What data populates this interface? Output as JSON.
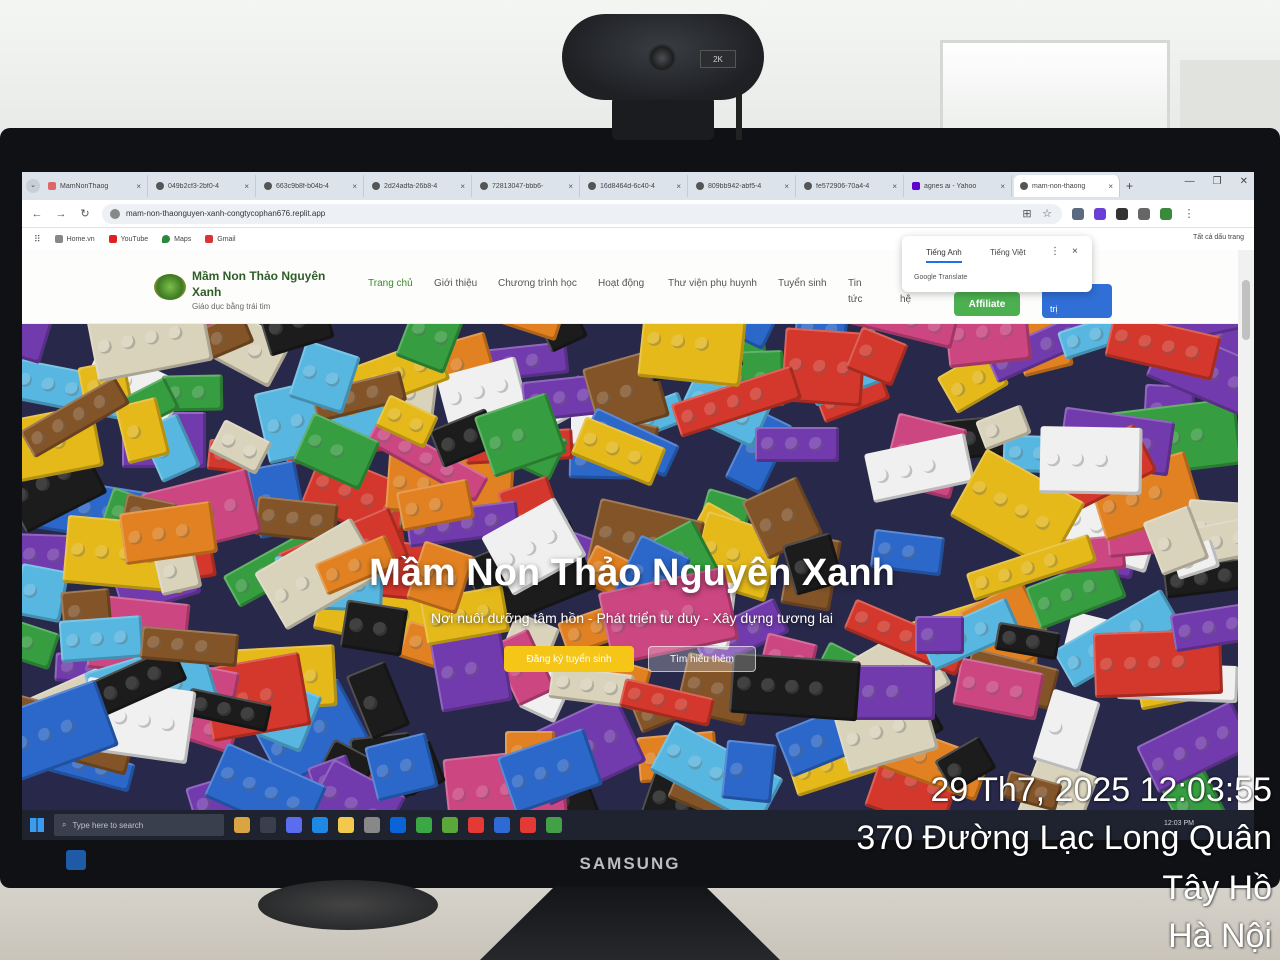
{
  "browser": {
    "tabs": [
      {
        "label": "MamNonThaog",
        "icon": "mnt-icon"
      },
      {
        "label": "049b2cf3-2bf0-4",
        "icon": "globe-icon"
      },
      {
        "label": "663c9b8f-b04b-4",
        "icon": "globe-icon"
      },
      {
        "label": "2d24adfa-26b8-4",
        "icon": "globe-icon"
      },
      {
        "label": "72813047-bbb6-",
        "icon": "globe-icon"
      },
      {
        "label": "16d8464d-6c40-4",
        "icon": "globe-icon"
      },
      {
        "label": "809bb942-abf5-4",
        "icon": "globe-icon"
      },
      {
        "label": "fe572906-70a4-4",
        "icon": "globe-icon"
      },
      {
        "label": "agnes ai - Yahoo",
        "icon": "yahoo-icon"
      },
      {
        "label": "mam-non-thaong",
        "icon": "globe-icon",
        "active": true
      }
    ],
    "new_tab": "+",
    "close_glyph": "×",
    "url": "mam-non-thaonguyen-xanh-congtycophan676.replit.app",
    "bookmarks": [
      {
        "label": "Home.vn",
        "icon": "home-vn-icon"
      },
      {
        "label": "YouTube",
        "icon": "youtube-icon"
      },
      {
        "label": "Maps",
        "icon": "maps-icon"
      },
      {
        "label": "Gmail",
        "icon": "gmail-icon"
      }
    ],
    "all_bookmarks": "Tất cả dấu trang"
  },
  "translate": {
    "lang_source": "Tiếng Anh",
    "lang_target": "Tiếng Việt",
    "brand": "Google Translate",
    "more": "⋮",
    "close": "×"
  },
  "site": {
    "brand_name": "Mầm Non Thảo Nguyên Xanh",
    "brand_tagline": "Giáo dục bằng trái tim",
    "menu": [
      {
        "label": "Trang chủ",
        "active": true
      },
      {
        "label": "Giới thiệu"
      },
      {
        "label": "Chương trình học"
      },
      {
        "label": "Hoạt động"
      },
      {
        "label": "Thư viện phụ huynh"
      },
      {
        "label": "Tuyển sinh"
      },
      {
        "label": "Tin tức"
      },
      {
        "label": "hệ"
      }
    ],
    "affiliate_label": "Affiliate",
    "admin_label": "trị"
  },
  "hero": {
    "title": "Mầm Non Thảo Nguyên Xanh",
    "subtitle": "Nơi nuôi dưỡng tâm hồn - Phát triển tư duy - Xây dựng tương lai",
    "primary_cta": "Đăng ký tuyển sinh",
    "secondary_cta": "Tìm hiểu thêm"
  },
  "taskbar": {
    "search_placeholder": "Type here to search",
    "tray_time": "12:03 PM"
  },
  "monitor": {
    "brand": "SAMSUNG",
    "webcam_badge": "2K"
  },
  "overlay": {
    "datetime": "29 Th7, 2025 12:03:55",
    "address": "370 Đường Lạc Long Quân",
    "district": "Tây Hồ",
    "city": "Hà Nội"
  },
  "colors": {
    "brand_green": "#2f5d2a",
    "menu_active": "#3a8a2b",
    "affiliate_bg": "#4caf50",
    "admin_bg": "#2f6fd6",
    "cta_yellow": "#f5c518"
  }
}
